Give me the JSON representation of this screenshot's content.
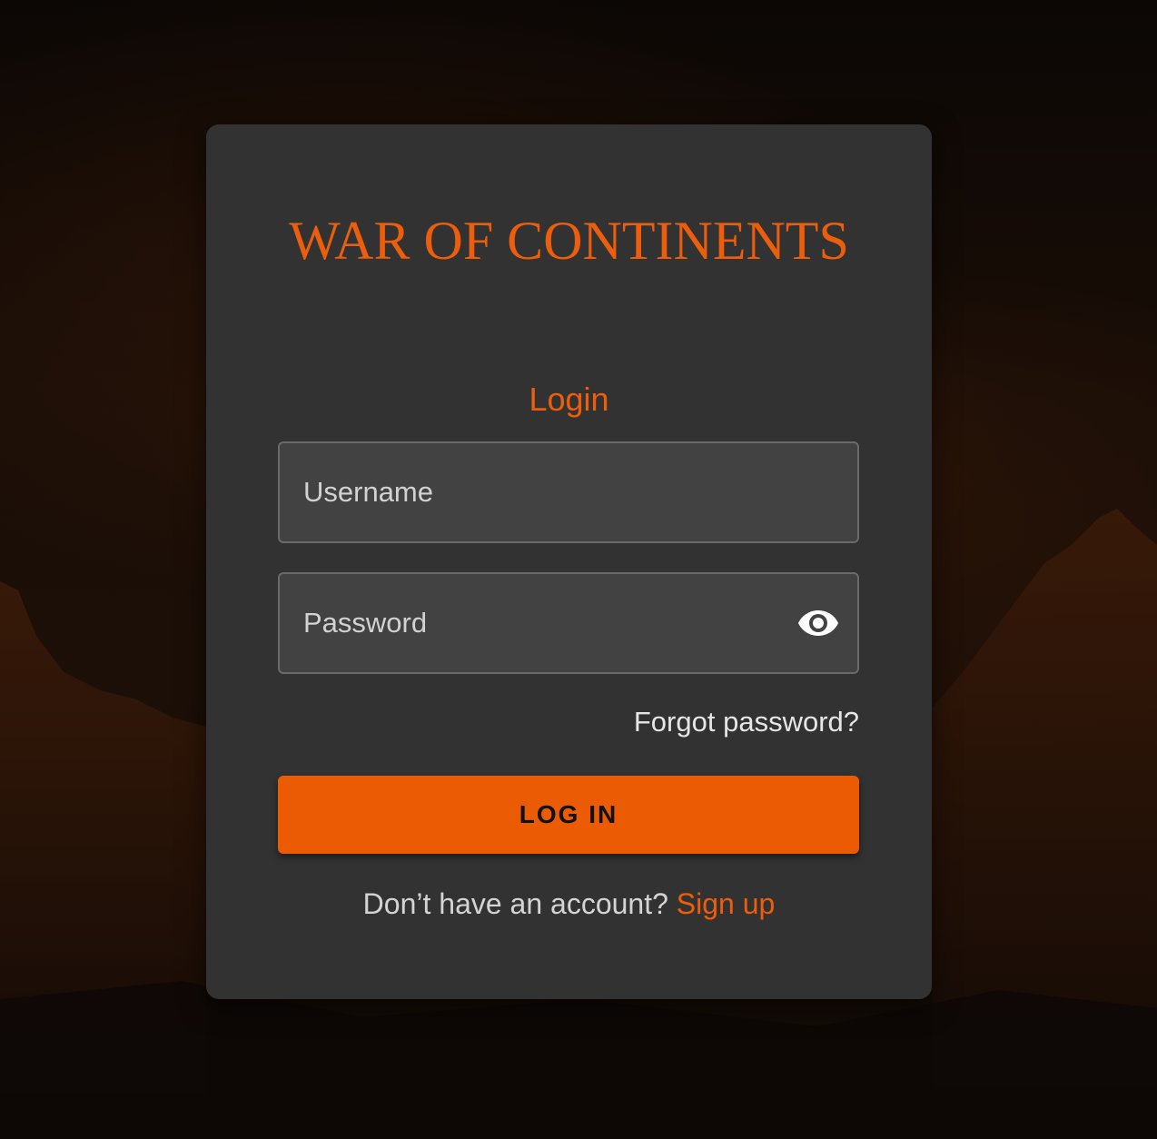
{
  "app": {
    "title": "WAR OF CONTINENTS"
  },
  "form": {
    "heading": "Login",
    "username": {
      "value": "",
      "placeholder": "Username"
    },
    "password": {
      "value": "",
      "placeholder": "Password",
      "toggle_icon": "eye-icon"
    },
    "forgot_label": "Forgot password?",
    "submit_label": "LOG IN",
    "signup_prompt": "Don’t have an account?",
    "signup_link": "Sign up"
  },
  "colors": {
    "accent": "#ec5e0b",
    "button": "#ea5b03",
    "card": "#333232",
    "field": "#424242"
  }
}
